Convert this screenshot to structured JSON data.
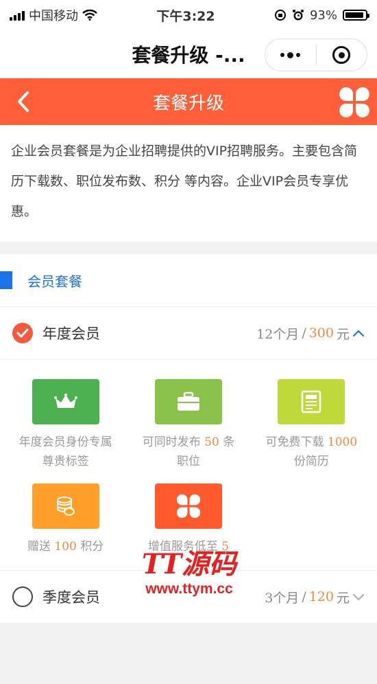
{
  "status_bar": {
    "carrier": "中国移动",
    "time": "下午3:22",
    "battery": "93%",
    "battery_level": 0.93
  },
  "nav": {
    "title": "套餐升级 -..."
  },
  "header": {
    "title": "套餐升级"
  },
  "intro": {
    "text": "企业会员套餐是为企业招聘提供的VIP招聘服务。主要包含简历下载数、职位发布数、积分 等内容。企业VIP会员专享优惠。"
  },
  "section": {
    "title": "会员套餐"
  },
  "plans": [
    {
      "name": "年度会员",
      "duration": "12个月",
      "slash": "/",
      "price": "300",
      "unit": "元",
      "selected": true
    },
    {
      "name": "季度会员",
      "duration": "3个月",
      "slash": "/",
      "price": "120",
      "unit": "元",
      "selected": false
    }
  ],
  "benefits": [
    {
      "icon": "crown-icon",
      "color": "#4caf50",
      "pre": "年度会员身份专属尊贵标签",
      "num": "",
      "post": ""
    },
    {
      "icon": "briefcase-icon",
      "color": "#8bc34a",
      "pre": "可同时发布 ",
      "num": "50",
      "post": " 条职位"
    },
    {
      "icon": "document-icon",
      "color": "#c0d93a",
      "pre": "可免费下载 ",
      "num": "1000",
      "post": "份简历"
    },
    {
      "icon": "coins-icon",
      "color": "#ff9f2a",
      "pre": "赠送 ",
      "num": "100",
      "post": " 积分"
    },
    {
      "icon": "apps-icon",
      "color": "#ff5a2e",
      "pre": "增值服务低至 ",
      "num": "5",
      "post": ""
    }
  ],
  "watermark": {
    "logo": "TT源码",
    "url": "www.ttym.cc"
  },
  "colors": {
    "primary": "#ff5f38",
    "accent_blue": "#1a73e8",
    "highlight": "#f0883a"
  }
}
